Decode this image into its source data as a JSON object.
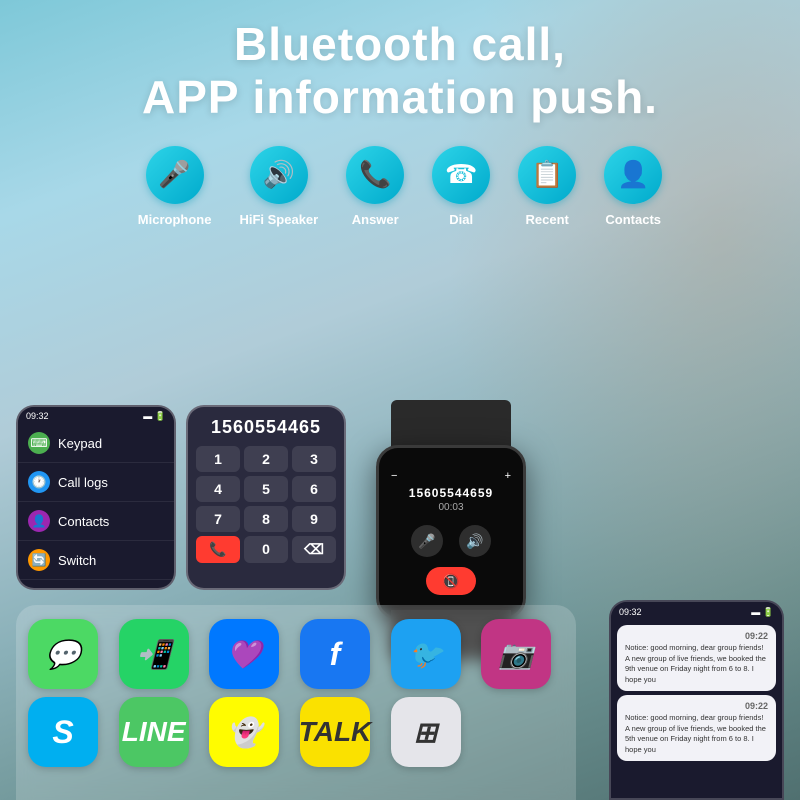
{
  "title": {
    "line1": "Bluetooth call,",
    "line2": "APP information push."
  },
  "features": [
    {
      "id": "microphone",
      "label": "Microphone",
      "icon": "🎤"
    },
    {
      "id": "hifi-speaker",
      "label": "HiFi Speaker",
      "icon": "🔊"
    },
    {
      "id": "answer",
      "label": "Answer",
      "icon": "📞"
    },
    {
      "id": "dial",
      "label": "Dial",
      "icon": "☎"
    },
    {
      "id": "recent",
      "label": "Recent",
      "icon": "📋"
    },
    {
      "id": "contacts",
      "label": "Contacts",
      "icon": "👤"
    }
  ],
  "phone_screen": {
    "time": "09:32",
    "battery": "🔋",
    "menu_items": [
      {
        "id": "keypad",
        "label": "Keypad",
        "icon": "⌨",
        "icon_color": "#4CAF50"
      },
      {
        "id": "call-logs",
        "label": "Call logs",
        "icon": "🕐",
        "icon_color": "#2196F3"
      },
      {
        "id": "contacts",
        "label": "Contacts",
        "icon": "👤",
        "icon_color": "#9C27B0"
      },
      {
        "id": "switch",
        "label": "Switch",
        "icon": "🔄",
        "icon_color": "#FF9800"
      }
    ]
  },
  "dialpad": {
    "number": "1560554465",
    "keys": [
      "1",
      "2",
      "3",
      "4",
      "5",
      "6",
      "7",
      "8",
      "9",
      "📞",
      "0",
      "⌫"
    ]
  },
  "watch": {
    "phone_number": "15605544659",
    "timer": "00:03",
    "minus_label": "−",
    "plus_label": "+"
  },
  "apps": [
    {
      "id": "messages",
      "label": "Messages",
      "icon": "💬",
      "bg": "#4CD964"
    },
    {
      "id": "whatsapp",
      "label": "WhatsApp",
      "icon": "📱",
      "bg": "#25D366"
    },
    {
      "id": "messenger",
      "label": "Messenger",
      "icon": "💬",
      "bg": "linear-gradient(135deg,#0078FF,#A033FF)"
    },
    {
      "id": "facebook",
      "label": "Facebook",
      "icon": "f",
      "bg": "#1877F2"
    },
    {
      "id": "twitter",
      "label": "Twitter",
      "icon": "🐦",
      "bg": "#1DA1F2"
    },
    {
      "id": "instagram",
      "label": "Instagram",
      "icon": "📷",
      "bg": "linear-gradient(135deg,#F58529,#DD2A7B,#8134AF)"
    },
    {
      "id": "skype",
      "label": "Skype",
      "icon": "S",
      "bg": "#00AFF0"
    },
    {
      "id": "line",
      "label": "LINE",
      "icon": "L",
      "bg": "#4CC764"
    },
    {
      "id": "snapchat",
      "label": "Snapchat",
      "icon": "👻",
      "bg": "#FFFC00"
    },
    {
      "id": "kakaotalk",
      "label": "KakaoTalk",
      "icon": "T",
      "bg": "#FAE100"
    },
    {
      "id": "grid-app",
      "label": "Grid App",
      "icon": "⊞",
      "bg": "#E5E5EA"
    }
  ],
  "notifications": {
    "time": "09:32",
    "battery": "🔋",
    "items": [
      {
        "timestamp": "09:22",
        "text": "Notice: good morning, dear group friends! A new group of live friends, we booked the 9th venue on Friday night from 6 to 8. I hope you"
      },
      {
        "timestamp": "09:22",
        "text": "Notice: good morning, dear group friends! A new group of live friends, we booked the 5th venue on Friday night from 6 to 8. I hope you"
      }
    ]
  },
  "colors": {
    "accent_teal": "#00aacc",
    "bg_dark": "#1a1a2e",
    "call_red": "#ff3b30",
    "feature_gradient_start": "#2dd4e8",
    "feature_gradient_end": "#00aacc"
  }
}
